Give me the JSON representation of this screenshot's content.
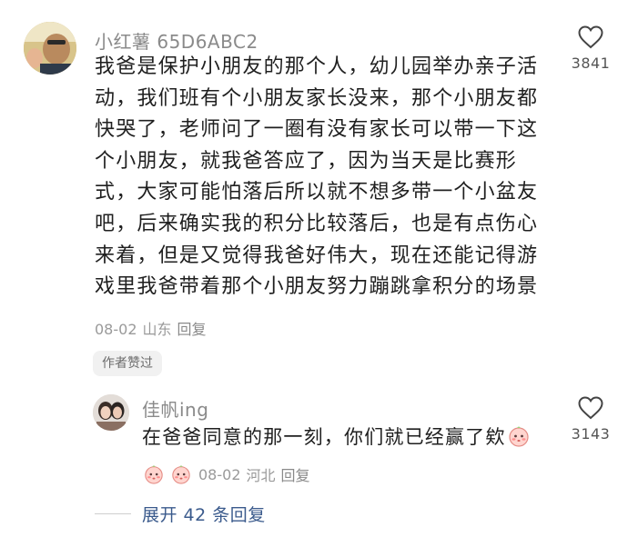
{
  "comment": {
    "username": "小红薯 65D6ABC2",
    "lines": [
      "我爸是保护小朋友的那个人，幼儿园举办亲子活",
      "动，我们班有个小朋友家长没来，那个小朋友都",
      "快哭了，老师问了一圈有没有家长可以带一下这",
      "个小朋友，就我爸答应了，因为当天是比赛形",
      "式，大家可能怕落后所以就不想多带一个小盆友",
      "吧，后来确实我的积分比较落后，也是有点伤心",
      "来着，但是又觉得我爸好伟大，现在还能记得游",
      "戏里我爸带着那个小朋友努力蹦跳拿积分的场景"
    ],
    "date": "08-02",
    "location": "山东",
    "reply_label": "回复",
    "author_badge": "作者赞过",
    "like_count": "3841",
    "like_icon": "heart-outline-icon"
  },
  "reply": {
    "username": "佳帆ing",
    "text": "在爸爸同意的那一刻，你们就已经赢了欸",
    "emoji_icon": "blushing-face-emoji",
    "date": "08-02",
    "location": "河北",
    "reply_label": "回复",
    "like_count": "3143",
    "like_icon": "heart-outline-icon"
  },
  "expand": {
    "label": "展开 42 条回复"
  },
  "colors": {
    "username": "#8a8a8a",
    "text": "#1f1f1f",
    "meta": "#9a9a9a",
    "link": "#3a5a8c",
    "badge_bg": "#f1f1f1"
  }
}
